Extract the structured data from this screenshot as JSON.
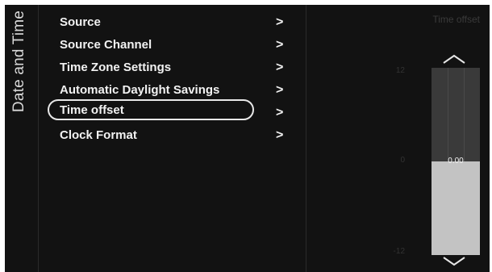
{
  "sidebar": {
    "title": "Date and Time"
  },
  "menu": {
    "items": [
      {
        "label": "Source",
        "chevron": ">"
      },
      {
        "label": "Source Channel",
        "chevron": ">"
      },
      {
        "label": "Time Zone Settings",
        "chevron": ">"
      },
      {
        "label": "Automatic Daylight Savings",
        "chevron": ">"
      },
      {
        "label": "Time offset",
        "chevron": ">",
        "selected": true
      },
      {
        "label": "Clock Format",
        "chevron": ">"
      }
    ]
  },
  "panel": {
    "title": "Time offset",
    "slider": {
      "max_label": "12",
      "mid_label": "0",
      "min_label": "-12",
      "value_label": "0.00",
      "fill_fraction": 0.5,
      "up_icon": "chevron-up-icon",
      "down_icon": "chevron-down-icon"
    }
  }
}
